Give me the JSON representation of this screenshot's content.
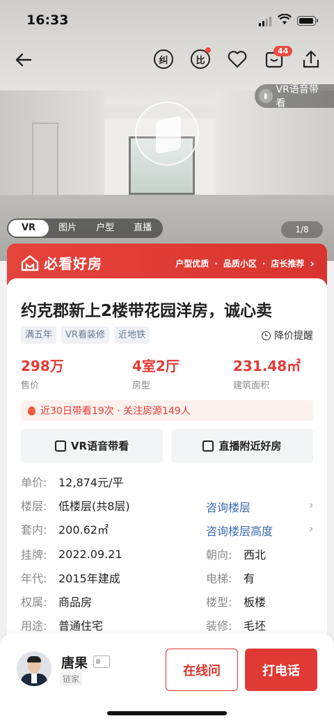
{
  "status_bar": {
    "time": "16:33"
  },
  "nav": {
    "correct_label": "纠",
    "compare_label": "比",
    "message_badge": "44"
  },
  "hero": {
    "vr_guide_label": "VR语音带看",
    "media_tabs": [
      "VR",
      "图片",
      "户型",
      "直播"
    ],
    "active_tab": "VR",
    "photo_counter": "1/8"
  },
  "banner": {
    "title": "必看好房",
    "tags": [
      "户型优质",
      "品质小区",
      "店长推荐"
    ],
    "chevron": "›"
  },
  "listing": {
    "title": "约克郡新上2楼带花园洋房，诚心卖",
    "tags": [
      "满五年",
      "VR看装修",
      "近地铁"
    ],
    "price_alert": "降价提醒",
    "stats": [
      {
        "value": "298万",
        "label": "售价"
      },
      {
        "value": "4室2厅",
        "label": "房型"
      },
      {
        "value": "231.48㎡",
        "label": "建筑面积"
      }
    ],
    "visit_info": "近30日带看19次 · 关注房源149人",
    "actions": {
      "vr_guide": "VR语音带看",
      "live_nearby": "直播附近好房"
    },
    "details": {
      "unit_price_label": "单价:",
      "unit_price": "12,874元/平",
      "floor_label": "楼层:",
      "floor": "低楼层(共8层)",
      "floor_link": "咨询楼层",
      "inner_label": "套内:",
      "inner_area": "200.62㎡",
      "height_link": "咨询楼层高度",
      "listed_label": "挂牌:",
      "listed_date": "2022.09.21",
      "orientation_label": "朝向:",
      "orientation": "西北",
      "year_label": "年代:",
      "year": "2015年建成",
      "elevator_label": "电梯:",
      "elevator": "有",
      "ownership_label": "权属:",
      "ownership": "商品房",
      "building_type_label": "楼型:",
      "building_type": "板楼",
      "usage_label": "用途:",
      "usage": "普通住宅",
      "decoration_label": "装修:",
      "decoration": "毛坯"
    }
  },
  "agent": {
    "name": "唐果",
    "company": "链家",
    "chat_label": "在线问",
    "call_label": "打电话"
  },
  "colors": {
    "brand_red": "#e03a35",
    "link_blue": "#3d6bb5"
  }
}
